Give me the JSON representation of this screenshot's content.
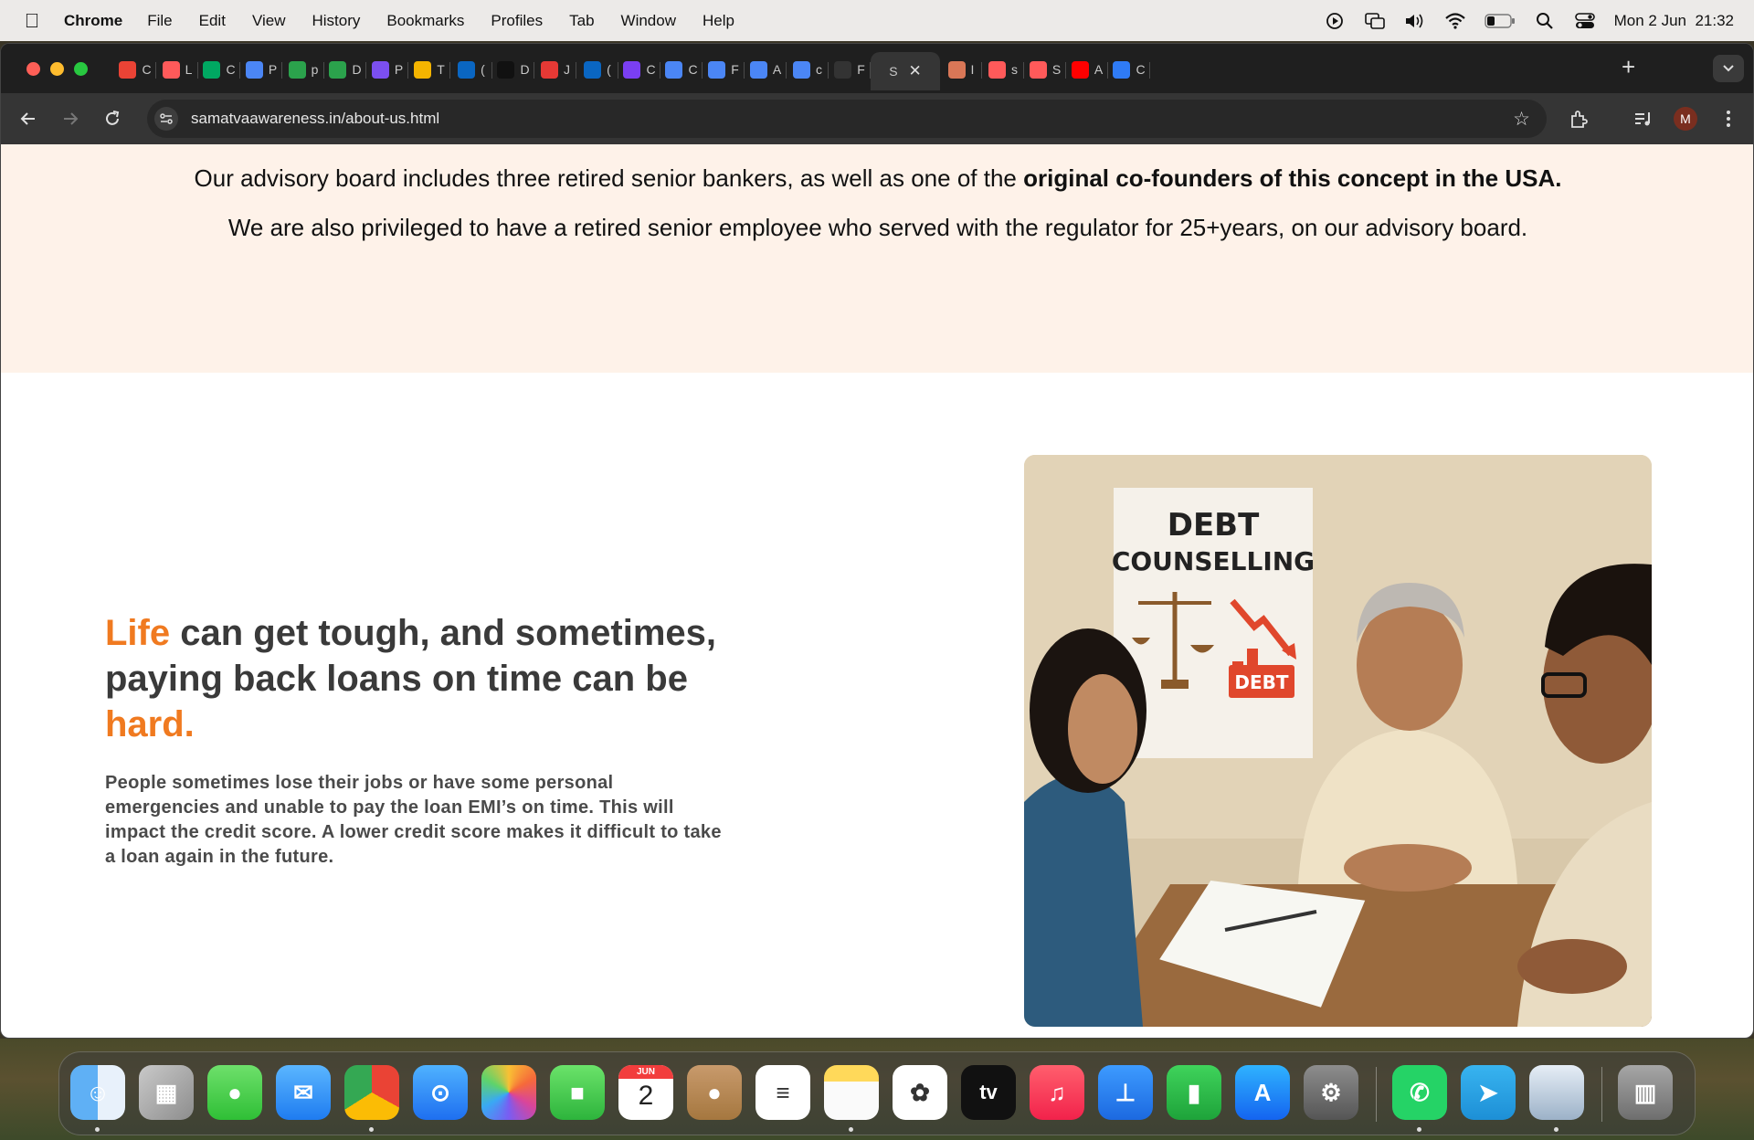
{
  "menubar": {
    "app_name": "Chrome",
    "items": [
      "File",
      "Edit",
      "View",
      "History",
      "Bookmarks",
      "Profiles",
      "Tab",
      "Window",
      "Help"
    ],
    "clock": "Mon 2 Jun  21:32",
    "status_icons": [
      "screen-recording-icon",
      "screen-mirroring-icon",
      "volume-icon",
      "wifi-icon",
      "battery-icon",
      "spotlight-search-icon",
      "control-center-icon"
    ]
  },
  "browser": {
    "tabs": [
      {
        "icon": "gmail-icon",
        "letter": "C",
        "color": "#ea4335"
      },
      {
        "icon": "shape-logo-icon",
        "letter": "L",
        "color": "#ff5a5a"
      },
      {
        "icon": "google-meet-icon",
        "letter": "C",
        "color": "#00a862"
      },
      {
        "icon": "google-docs-icon",
        "letter": "P",
        "color": "#4b86f5"
      },
      {
        "icon": "google-drive-icon",
        "letter": "p",
        "color": "#2ba24c"
      },
      {
        "icon": "google-drive-icon",
        "letter": "D",
        "color": "#2ba24c"
      },
      {
        "icon": "arrow-logo-icon",
        "letter": "P",
        "color": "#7b4ff0"
      },
      {
        "icon": "google-slides-icon",
        "letter": "T",
        "color": "#f4b400"
      },
      {
        "icon": "linkedin-icon",
        "letter": "(",
        "color": "#0a66c2"
      },
      {
        "icon": "stripes-logo-icon",
        "letter": "D",
        "color": "#111111"
      },
      {
        "icon": "red-app-icon",
        "letter": "J",
        "color": "#e53935"
      },
      {
        "icon": "linkedin-icon",
        "letter": "(",
        "color": "#0a66c2"
      },
      {
        "icon": "slack-like-icon",
        "letter": "C",
        "color": "#7a3ff2"
      },
      {
        "icon": "google-docs-icon",
        "letter": "C",
        "color": "#4b86f5"
      },
      {
        "icon": "google-docs-icon",
        "letter": "F",
        "color": "#4b86f5"
      },
      {
        "icon": "google-docs-icon",
        "letter": "A",
        "color": "#4b86f5"
      },
      {
        "icon": "google-docs-icon",
        "letter": "c",
        "color": "#4b86f5"
      },
      {
        "icon": "openai-icon",
        "letter": "F",
        "color": "#333333"
      },
      {
        "icon": "site-favicon-icon",
        "letter": "S",
        "color": "#353535",
        "active": true
      },
      {
        "icon": "claude-icon",
        "letter": "I",
        "color": "#d97757"
      },
      {
        "icon": "shape-logo-icon",
        "letter": "s",
        "color": "#ff5a5a"
      },
      {
        "icon": "shape-logo-icon",
        "letter": "S",
        "color": "#ff5a5a"
      },
      {
        "icon": "youtube-icon",
        "letter": "A",
        "color": "#ff0000"
      },
      {
        "icon": "blue-app-icon",
        "letter": "C",
        "color": "#2f7bf5"
      }
    ],
    "url": "samatvaawareness.in/about-us.html",
    "profile_initial": "M"
  },
  "page": {
    "advisory_line1_prefix": "Our advisory board includes three retired senior bankers, as well as one of the ",
    "advisory_line1_bold": "original co-founders of this concept in the USA.",
    "advisory_line2": "We are also privileged to have a retired senior employee who served with the regulator for 25+years, on our advisory board.",
    "hero_title_accent1": "Life",
    "hero_title_middle": " can get tough, and sometimes, paying back loans on time can be ",
    "hero_title_accent2": "hard.",
    "hero_body": "People sometimes lose their jobs or have some personal emergencies and unable to pay the loan EMI’s on time. This will impact the credit score. A lower credit score makes it difficult to take a loan again in the future.",
    "image": {
      "poster_line1": "DEBT",
      "poster_line2": "COUNSELLING",
      "poster_badge": "DEBT"
    }
  },
  "dock": {
    "apps": [
      "finder-icon",
      "launchpad-icon",
      "messages-icon",
      "mail-icon",
      "chrome-icon",
      "safari-icon",
      "photos-icon",
      "facetime-icon",
      "calendar-icon",
      "contacts-icon",
      "reminders-icon",
      "notes-icon",
      "chatgpt-icon",
      "apple-tv-icon",
      "music-icon",
      "keynote-icon",
      "numbers-icon",
      "app-store-icon",
      "system-settings-icon",
      "whatsapp-icon",
      "telegram-icon",
      "preview-icon",
      "trash-icon"
    ],
    "calendar_month": "JUN",
    "calendar_day": "2",
    "tv_label": "tv"
  },
  "colors": {
    "accent_orange": "#f07a20",
    "advisory_bg": "#fef2e9"
  }
}
